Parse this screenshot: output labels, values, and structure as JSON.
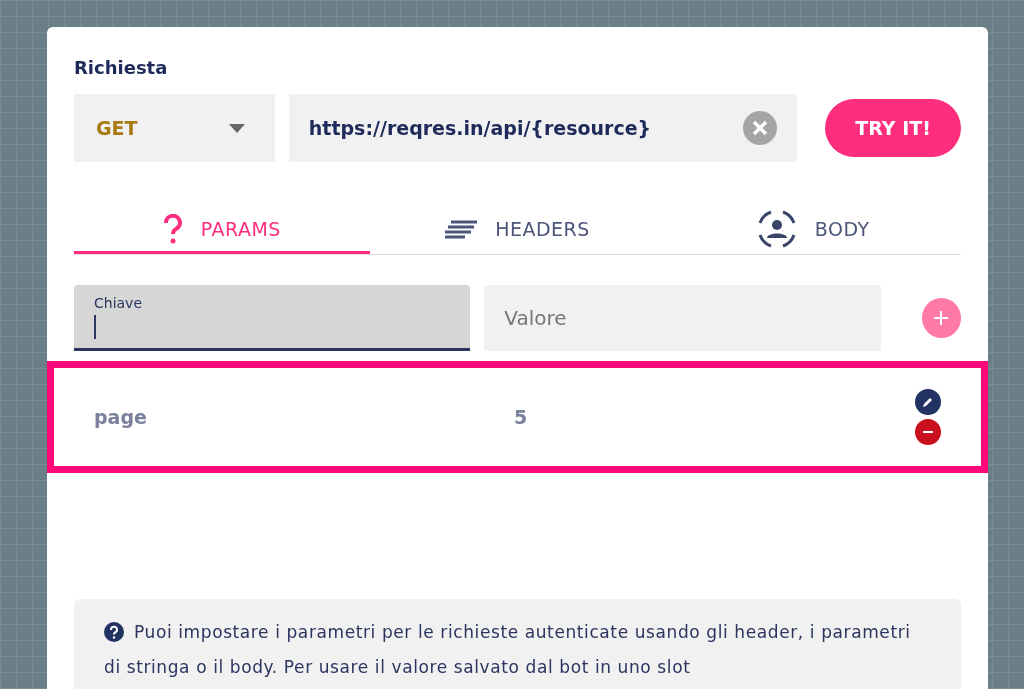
{
  "panel": {
    "title": "Richiesta"
  },
  "request": {
    "method": "GET",
    "url": "https://reqres.in/api/{resource}",
    "button": "TRY IT!"
  },
  "tabs": [
    {
      "label": "PARAMS",
      "kind": "question",
      "selected": true
    },
    {
      "label": "HEADERS",
      "kind": "lines",
      "selected": false
    },
    {
      "label": "BODY",
      "kind": "person",
      "selected": false
    }
  ],
  "new_param": {
    "key_label": "Chiave",
    "value_placeholder": "Valore",
    "focused": true
  },
  "params": [
    {
      "key": "page",
      "value": "5",
      "highlighted": true
    }
  ],
  "note": "Puoi impostare i parametri per le richieste autenticate usando gli header, i parametri di stringa o il body. Per usare il valore salvato dal bot in uno slot"
}
